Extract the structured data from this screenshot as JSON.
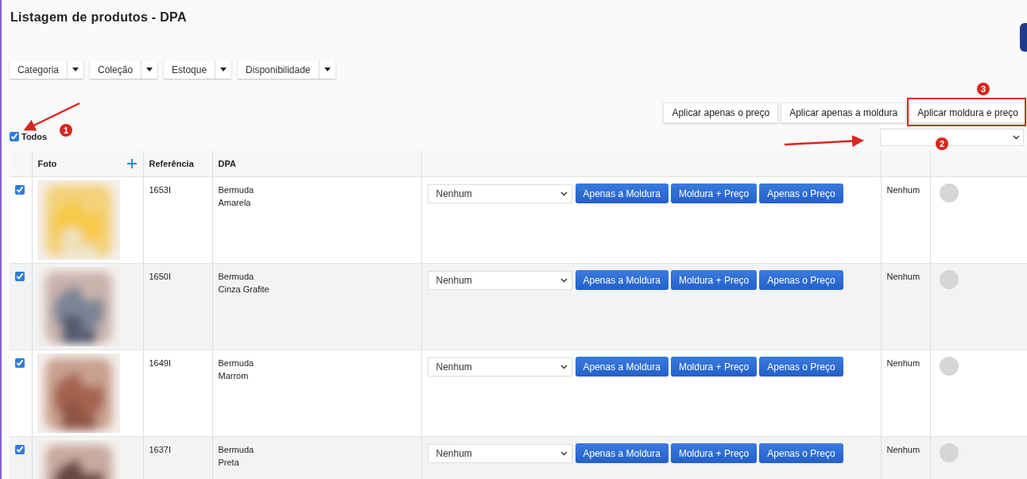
{
  "title": "Listagem de produtos - DPA",
  "filters": [
    {
      "label": "Categoria"
    },
    {
      "label": "Coleção"
    },
    {
      "label": "Estoque"
    },
    {
      "label": "Disponibilidade"
    }
  ],
  "bulk_actions": [
    "Aplicar apenas o preço",
    "Aplicar apenas a moldura",
    "Aplicar moldura e preço"
  ],
  "select_all": {
    "label": "Todos",
    "checked": true
  },
  "table": {
    "columns": [
      "Foto",
      "Referência",
      "DPA"
    ],
    "rows": [
      {
        "checked": true,
        "photo": {
          "kind": "picture"
        },
        "reference": "1653I",
        "name": "Bermuda",
        "variant": "Amarela",
        "frame": "Nenhum",
        "buttons": [
          "Apenas a Moldura",
          "Moldura + Preço",
          "Apenas o Preço"
        ],
        "status": "Nenhum"
      },
      {
        "checked": true,
        "photo": {
          "kind": "picture"
        },
        "reference": "1650I",
        "name": "Bermuda",
        "variant": "Cinza Grafite",
        "frame": "Nenhum",
        "buttons": [
          "Apenas a Moldura",
          "Moldura + Preço",
          "Apenas o Preço"
        ],
        "status": "Nenhum"
      },
      {
        "checked": true,
        "photo": {
          "kind": "picture"
        },
        "reference": "1649I",
        "name": "Bermuda",
        "variant": "Marrom",
        "frame": "Nenhum",
        "buttons": [
          "Apenas a Moldura",
          "Moldura + Preço",
          "Apenas o Preço"
        ],
        "status": "Nenhum"
      },
      {
        "checked": true,
        "photo": {
          "kind": "picture"
        },
        "reference": "1637I",
        "name": "Bermuda",
        "variant": "Preta",
        "frame": "Nenhum",
        "buttons": [
          "Apenas a Moldura",
          "Moldura + Preço",
          "Apenas o Preço"
        ],
        "status": "Nenhum"
      }
    ]
  },
  "annotations": [
    {
      "label": "1"
    },
    {
      "label": "2"
    },
    {
      "label": "3"
    }
  ]
}
